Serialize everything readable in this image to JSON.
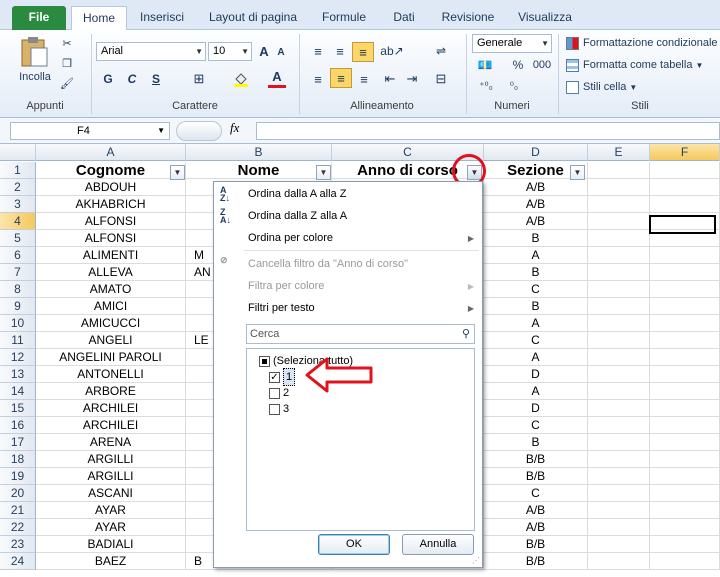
{
  "tabs": [
    "File",
    "Home",
    "Inserisci",
    "Layout di pagina",
    "Formule",
    "Dati",
    "Revisione",
    "Visualizza"
  ],
  "ribbon": {
    "paste_label": "Incolla",
    "font_name": "Arial",
    "font_size": "10",
    "number_format": "Generale",
    "cond_format": "Formattazione condizionale",
    "format_table": "Formatta come tabella",
    "cell_styles": "Stili cella",
    "groups": {
      "appunti": "Appunti",
      "carattere": "Carattere",
      "allineamento": "Allineamento",
      "numeri": "Numeri",
      "stili": "Stili"
    },
    "bold": "G",
    "italic": "C",
    "underline": "S",
    "percent": "%",
    "thousands": "000"
  },
  "formula_bar": {
    "name_box": "F4",
    "fx": "fx",
    "value": ""
  },
  "columns": [
    "A",
    "B",
    "C",
    "D",
    "E",
    "F"
  ],
  "headers": {
    "a": "Cognome",
    "b": "Nome",
    "c": "Anno di corso",
    "d": "Sezione"
  },
  "rows": [
    {
      "n": "1"
    },
    {
      "n": "2",
      "a": "ABDOUH",
      "b": "",
      "d": "A/B"
    },
    {
      "n": "3",
      "a": "AKHABRICH",
      "b": "",
      "d": "A/B"
    },
    {
      "n": "4",
      "a": "ALFONSI",
      "b": "",
      "d": "A/B"
    },
    {
      "n": "5",
      "a": "ALFONSI",
      "b": "",
      "d": "B"
    },
    {
      "n": "6",
      "a": "ALIMENTI",
      "b": "M",
      "d": "A"
    },
    {
      "n": "7",
      "a": "ALLEVA",
      "b": "AN",
      "d": "B"
    },
    {
      "n": "8",
      "a": "AMATO",
      "b": "",
      "d": "C"
    },
    {
      "n": "9",
      "a": "AMICI",
      "b": "",
      "d": "B"
    },
    {
      "n": "10",
      "a": "AMICUCCI",
      "b": "",
      "d": "A"
    },
    {
      "n": "11",
      "a": "ANGELI",
      "b": "LE",
      "d": "C"
    },
    {
      "n": "12",
      "a": "ANGELINI PAROLI",
      "b": "",
      "d": "A"
    },
    {
      "n": "13",
      "a": "ANTONELLI",
      "b": "",
      "d": "D"
    },
    {
      "n": "14",
      "a": "ARBORE",
      "b": "",
      "d": "A"
    },
    {
      "n": "15",
      "a": "ARCHILEI",
      "b": "",
      "d": "D"
    },
    {
      "n": "16",
      "a": "ARCHILEI",
      "b": "",
      "d": "C"
    },
    {
      "n": "17",
      "a": "ARENA",
      "b": "",
      "d": "B"
    },
    {
      "n": "18",
      "a": "ARGILLI",
      "b": "",
      "d": "B/B"
    },
    {
      "n": "19",
      "a": "ARGILLI",
      "b": "",
      "d": "B/B"
    },
    {
      "n": "20",
      "a": "ASCANI",
      "b": "",
      "d": "C"
    },
    {
      "n": "21",
      "a": "AYAR",
      "b": "",
      "d": "A/B"
    },
    {
      "n": "22",
      "a": "AYAR",
      "b": "",
      "d": "A/B"
    },
    {
      "n": "23",
      "a": "BADIALI",
      "b": "",
      "d": "B/B"
    },
    {
      "n": "24",
      "a": "BAEZ",
      "b": "B",
      "d": "B/B"
    }
  ],
  "filter_menu": {
    "sort_az": "Ordina dalla A alla Z",
    "sort_za": "Ordina dalla Z alla A",
    "sort_color": "Ordina per colore",
    "clear_filter": "Cancella filtro da \"Anno di corso\"",
    "filter_color": "Filtra per colore",
    "text_filters": "Filtri per testo",
    "search_placeholder": "Cerca",
    "select_all": "(Seleziona tutto)",
    "items": [
      {
        "label": "1",
        "checked": true
      },
      {
        "label": "2",
        "checked": false
      },
      {
        "label": "3",
        "checked": false
      }
    ],
    "ok": "OK",
    "cancel": "Annulla"
  },
  "colors": {
    "file_tab": "#2a8a3f",
    "annotation": "#e0121b",
    "active_col": "#f9d77e"
  }
}
